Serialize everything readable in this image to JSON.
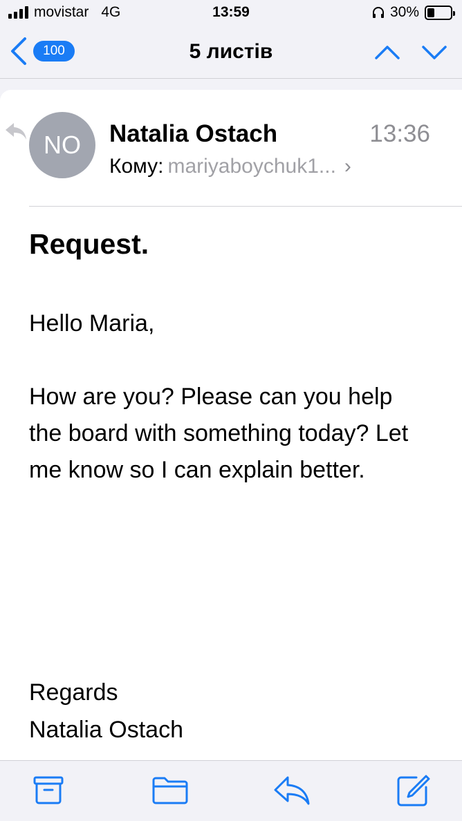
{
  "status": {
    "carrier": "movistar",
    "network": "4G",
    "time": "13:59",
    "battery_percent": "30%",
    "battery_level": 0.3
  },
  "navbar": {
    "badge_count": "100",
    "title": "5 листів"
  },
  "email": {
    "avatar_initials": "NO",
    "sender": "Natalia Ostach",
    "time": "13:36",
    "to_label": "Кому:",
    "to_value": "mariyaboychuk1...",
    "subject": "Request.",
    "greeting": "Hello Maria,",
    "message": "How are you? Please can you help the board with something today? Let me know so I can explain better.",
    "regards": "Regards",
    "signature": "Natalia Ostach"
  },
  "toolbar": {
    "icons": [
      "archive-icon",
      "folder-icon",
      "reply-icon",
      "compose-icon"
    ]
  },
  "colors": {
    "accent": "#1a7cf5",
    "avatar": "#a2a6b0",
    "secondary_text": "#8e8e93"
  }
}
